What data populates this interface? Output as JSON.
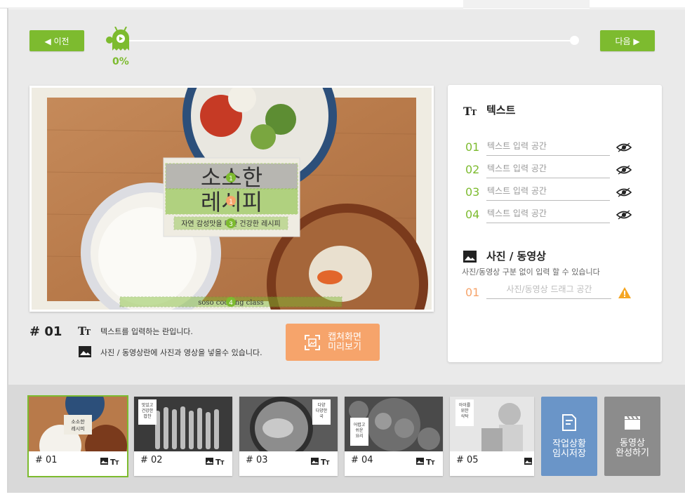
{
  "nav": {
    "prev_label": "◀ 이전",
    "next_label": "다음 ▶",
    "progress_text": "0%",
    "progress_value": 0
  },
  "stage": {
    "title_line1": "소소한",
    "title_line2": "레시피",
    "subtitle": "자연 감성맛을 더한 건강한 레시피",
    "footer_text": "soso cooking class",
    "markers": [
      "1",
      "1",
      "3",
      "4"
    ]
  },
  "scene": {
    "number": "# 01",
    "text_desc": "텍스트를 입력하는 란입니다.",
    "media_desc": "사진 / 동영상란에 사진과 영상을 넣을수 있습니다.",
    "capture_label_1": "캡쳐화면",
    "capture_label_2": "미리보기"
  },
  "panel": {
    "text_title": "텍스트",
    "text_rows": [
      {
        "num": "01",
        "placeholder": "텍스트 입력 공간"
      },
      {
        "num": "02",
        "placeholder": "텍스트 입력 공간"
      },
      {
        "num": "03",
        "placeholder": "텍스트 입력 공간"
      },
      {
        "num": "04",
        "placeholder": "텍스트 입력 공간"
      }
    ],
    "media_title": "사진 / 동영상",
    "media_desc": "사진/동영상 구분 없이 입력 할 수 있습니다",
    "media_row": {
      "num": "01",
      "placeholder": "사진/동영상 드래그 공간"
    }
  },
  "thumbs": [
    {
      "num": "# 01",
      "caption": "소소한 레시피"
    },
    {
      "num": "# 02",
      "caption": "맛있고 건강한 밥찬"
    },
    {
      "num": "# 03",
      "caption": "다양 다양한 국"
    },
    {
      "num": "# 04",
      "caption": "어렵고 쉬운 요리"
    },
    {
      "num": "# 05",
      "caption": "아이를 위한 식탁"
    }
  ],
  "actions": {
    "save_line1": "작업상황",
    "save_line2": "임시저장",
    "done_line1": "동영상",
    "done_line2": "완성하기"
  },
  "colors": {
    "accent": "#7dbb2f",
    "orange": "#f6a46b",
    "warn": "#f5a623",
    "save": "#6a95c8",
    "done": "#8c8c8c"
  }
}
